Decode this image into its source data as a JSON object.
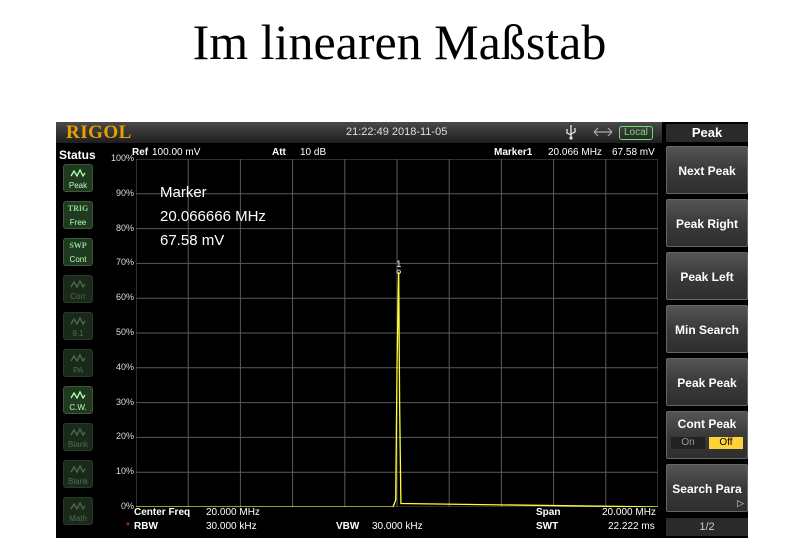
{
  "slide": {
    "title": "Im linearen Maßstab"
  },
  "topbar": {
    "brand": "RIGOL",
    "datetime": "21:22:49 2018-11-05",
    "local_label": "Local"
  },
  "status_panel": {
    "title": "Status",
    "buttons": [
      {
        "top": "",
        "bottom": "Peak",
        "icon": "peak-wave-icon",
        "state": "active"
      },
      {
        "top": "TRIG",
        "bottom": "Free",
        "icon": "",
        "state": "active"
      },
      {
        "top": "SWP",
        "bottom": "Cont",
        "icon": "",
        "state": "active"
      },
      {
        "top": "",
        "bottom": "Corr",
        "icon": "corr-icon",
        "state": "dim"
      },
      {
        "top": "",
        "bottom": "9.1",
        "icon": "trace-icon",
        "state": "dim"
      },
      {
        "top": "",
        "bottom": "PA",
        "icon": "pa-icon",
        "state": "dim"
      },
      {
        "top": "",
        "bottom": "C.W.",
        "icon": "cw-wave-icon",
        "state": "active"
      },
      {
        "top": "",
        "bottom": "Blank",
        "icon": "blank-icon",
        "state": "dim"
      },
      {
        "top": "",
        "bottom": "Blank",
        "icon": "blank-icon",
        "state": "dim"
      },
      {
        "top": "",
        "bottom": "Math",
        "icon": "math-icon",
        "state": "dim"
      }
    ]
  },
  "header": {
    "ref_label": "Ref",
    "ref_value": "100.00 mV",
    "att_label": "Att",
    "att_value": "10 dB",
    "marker_label": "Marker1",
    "marker_freq": "20.066 MHz",
    "marker_amp": "67.58 mV"
  },
  "y_ticks": [
    "100%",
    "90%",
    "80%",
    "70%",
    "60%",
    "50%",
    "40%",
    "30%",
    "20%",
    "10%",
    "0%"
  ],
  "marker_box": {
    "title": "Marker",
    "freq": "20.066666 MHz",
    "amp": "67.58 mV",
    "number": "1"
  },
  "bottom": {
    "center_label": "Center Freq",
    "center_value": "20.000 MHz",
    "rbw_label": "RBW",
    "rbw_value": "30.000 kHz",
    "vbw_label": "VBW",
    "vbw_value": "30.000 kHz",
    "span_label": "Span",
    "span_value": "20.000 MHz",
    "swt_label": "SWT",
    "swt_value": "22.222 ms"
  },
  "softkeys": {
    "menu_title": "Peak",
    "items": [
      "Next Peak",
      "Peak Right",
      "Peak Left",
      "Min Search",
      "Peak Peak"
    ],
    "cont_peak": {
      "label": "Cont Peak",
      "on": "On",
      "off": "Off",
      "selected": "Off"
    },
    "search_para": "Search Para",
    "page": "1/2"
  },
  "chart_data": {
    "type": "line",
    "x_range": [
      10,
      30
    ],
    "y_range": [
      0,
      100
    ],
    "series": [
      {
        "x": [
          10,
          19.85,
          19.95,
          20.0,
          20.05,
          20.066,
          20.1,
          20.15,
          30
        ],
        "y": [
          0,
          0,
          2,
          40,
          62,
          67.58,
          30,
          1,
          0
        ]
      }
    ],
    "marker": {
      "x": 20.066,
      "y": 67.58
    },
    "grid": true,
    "colors": {
      "trace": "#ffff33",
      "grid": "#5a5a5a",
      "accent": "#e8a000",
      "selected": "#ffd23a"
    }
  }
}
